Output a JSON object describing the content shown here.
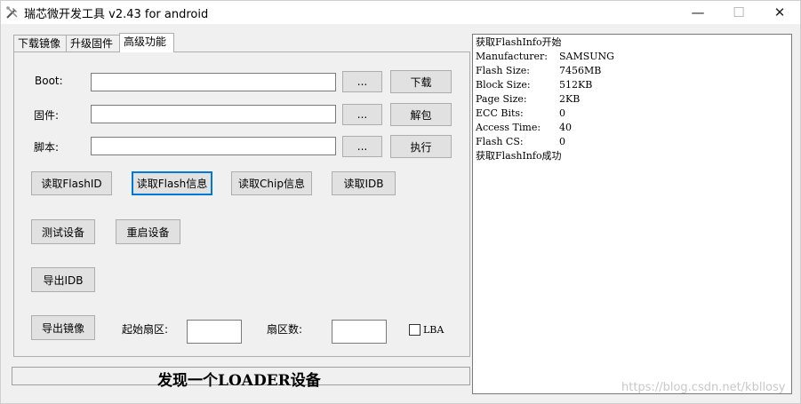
{
  "window": {
    "title": "瑞芯微开发工具 v2.43 for android",
    "minimize": "—",
    "maximize": "☐",
    "close": "✕",
    "icon": "tools-icon"
  },
  "tabs": [
    {
      "label": "下载镜像",
      "active": false
    },
    {
      "label": "升级固件",
      "active": false
    },
    {
      "label": "高级功能",
      "active": true
    }
  ],
  "rows": {
    "boot": {
      "label": "Boot:",
      "value": "",
      "browse": "...",
      "action": "下载"
    },
    "firmware": {
      "label": "固件:",
      "value": "",
      "browse": "...",
      "action": "解包"
    },
    "script": {
      "label": "脚本:",
      "value": "",
      "browse": "...",
      "action": "执行"
    }
  },
  "buttons": {
    "read_flash_id": "读取FlashID",
    "read_flash_info": "读取Flash信息",
    "read_chip_info": "读取Chip信息",
    "read_idb": "读取IDB",
    "test_device": "测试设备",
    "reboot_device": "重启设备",
    "export_idb": "导出IDB",
    "export_image": "导出镜像"
  },
  "export": {
    "start_sector_label": "起始扇区:",
    "start_sector_value": "",
    "sector_count_label": "扇区数:",
    "sector_count_value": "",
    "lba_label": "LBA",
    "lba_checked": false
  },
  "status": "发现一个LOADER设备",
  "log": {
    "start": "获取FlashInfo开始",
    "entries": [
      {
        "key": "Manufacturer:",
        "value": "SAMSUNG"
      },
      {
        "key": "Flash Size:",
        "value": "7456MB"
      },
      {
        "key": "Block Size:",
        "value": "512KB"
      },
      {
        "key": "Page Size:",
        "value": "2KB"
      },
      {
        "key": "ECC Bits:",
        "value": "0"
      },
      {
        "key": "Access Time:",
        "value": "40"
      },
      {
        "key": "Flash CS:",
        "value": "0"
      }
    ],
    "end": "获取FlashInfo成功"
  },
  "watermark": "https://blog.csdn.net/kbllosy"
}
